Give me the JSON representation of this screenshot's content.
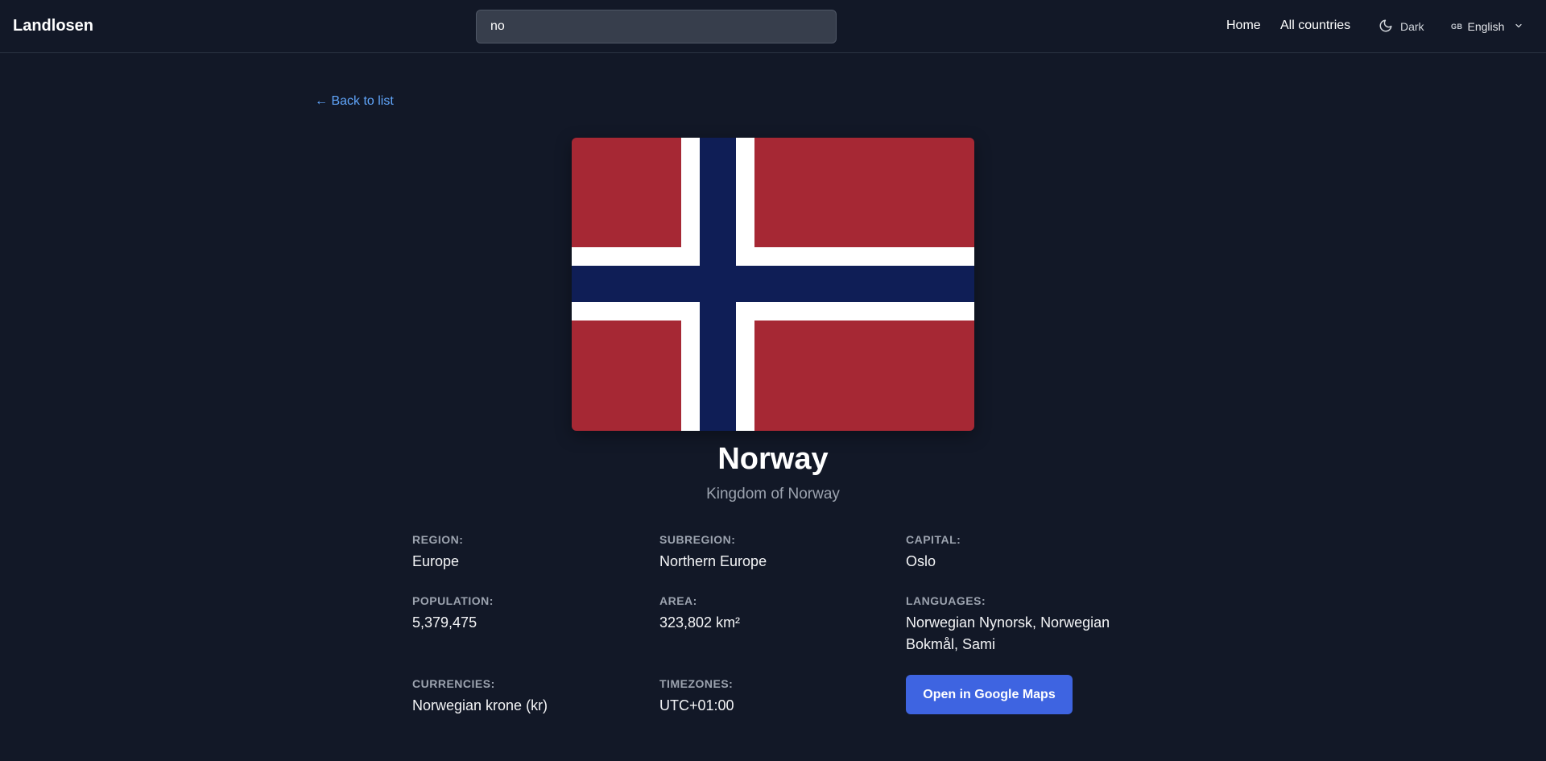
{
  "header": {
    "brand": "Landlosen",
    "search": {
      "value": "no",
      "placeholder": ""
    },
    "nav": {
      "home": "Home",
      "all_countries": "All countries"
    },
    "theme": {
      "label": "Dark",
      "icon": "moon-icon"
    },
    "language": {
      "flag_code": "GB",
      "label": "English",
      "icon": "chevron-down-icon"
    }
  },
  "back_link": "← Back to list",
  "flag": {
    "icon": "norway-flag",
    "colors": {
      "red": "#a62834",
      "white": "#ffffff",
      "blue": "#0f1e56"
    }
  },
  "country": {
    "name": "Norway",
    "official_name": "Kingdom of Norway"
  },
  "facts": {
    "region": {
      "label": "REGION:",
      "value": "Europe"
    },
    "subregion": {
      "label": "SUBREGION:",
      "value": "Northern Europe"
    },
    "capital": {
      "label": "CAPITAL:",
      "value": "Oslo"
    },
    "population": {
      "label": "POPULATION:",
      "value": "5,379,475"
    },
    "area": {
      "label": "AREA:",
      "value": "323,802 km²"
    },
    "languages": {
      "label": "LANGUAGES:",
      "value": "Norwegian Nynorsk, Norwegian Bokmål, Sami"
    },
    "currencies": {
      "label": "CURRENCIES:",
      "value": "Norwegian krone (kr)"
    },
    "timezones": {
      "label": "TIMEZONES:",
      "value": "UTC+01:00"
    }
  },
  "maps_button": "Open in Google Maps",
  "colors": {
    "background": "#121827",
    "accent": "#3e64e1",
    "link": "#60a5fa"
  }
}
